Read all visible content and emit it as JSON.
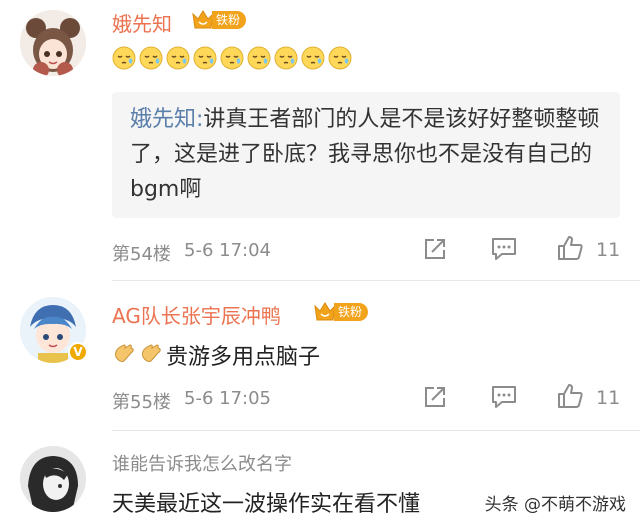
{
  "comments": [
    {
      "username": "娥先知",
      "fan_badge": "铁粉",
      "emoji": "sleepy-face",
      "emoji_count": 9,
      "quote_user": "娥先知:",
      "quote_text": "讲真王者部门的人是不是该好好整顿整顿了，这是进了卧底？我寻思你也不是没有自己的bgm啊",
      "floor": "第54楼",
      "time": "5-6 17:04",
      "likes": "11"
    },
    {
      "username": "AG队长张宇辰冲鸭",
      "fan_badge": "铁粉",
      "verified": "V",
      "emoji": "clap-hands",
      "text": "贵游多用点脑子",
      "floor": "第55楼",
      "time": "5-6 17:05",
      "likes": "11"
    },
    {
      "username": "谁能告诉我怎么改名字",
      "text": "天美最近这一波操作实在看不懂"
    }
  ],
  "watermark": "头条 @不萌不游戏",
  "colors": {
    "username": "#eb7350",
    "quote_name": "#5a7faa",
    "meta": "#8c8c8c",
    "badge": "#f2a31c"
  }
}
